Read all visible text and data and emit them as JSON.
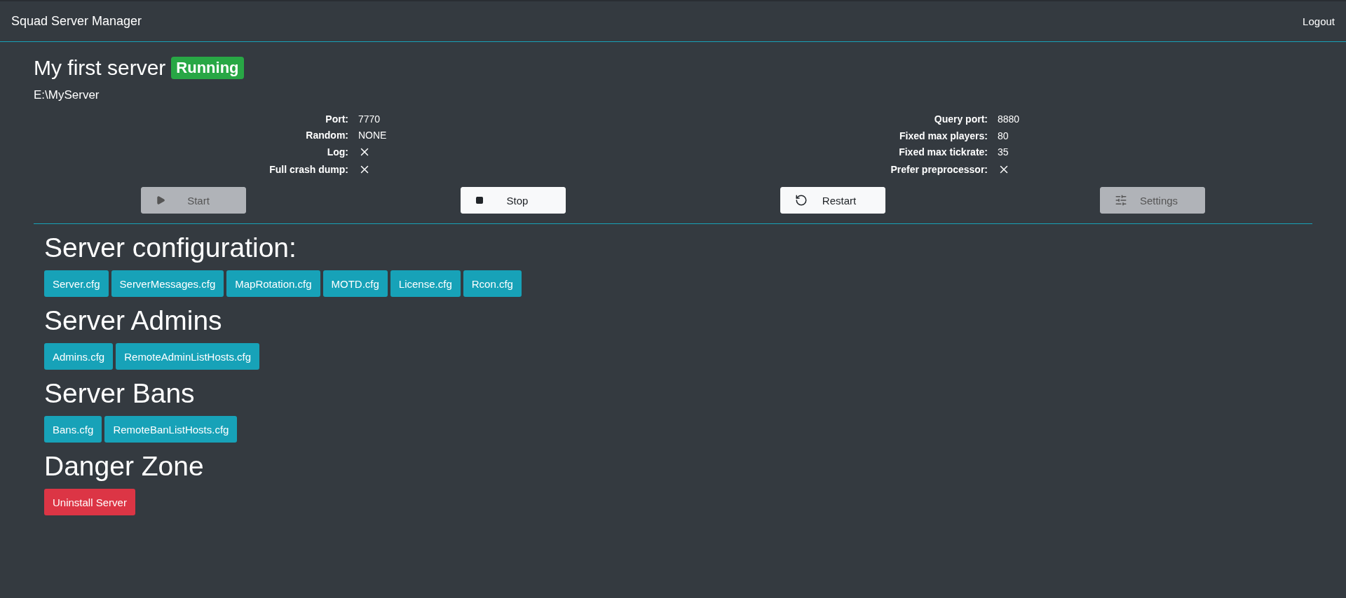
{
  "navbar": {
    "brand": "Squad Server Manager",
    "logout": "Logout"
  },
  "server": {
    "name": "My first server",
    "status": {
      "label": "Running",
      "kind": "running"
    },
    "path": "E:\\MyServer"
  },
  "info_columns": [
    [
      {
        "label": "Port:",
        "kind": "text",
        "value": "7770"
      },
      {
        "label": "Random:",
        "kind": "text",
        "value": "NONE"
      },
      {
        "label": "Log:",
        "kind": "flag",
        "on": false
      },
      {
        "label": "Full crash dump:",
        "kind": "flag",
        "on": false
      }
    ],
    [
      {
        "label": "Query port:",
        "kind": "text",
        "value": "8880"
      },
      {
        "label": "Fixed max players:",
        "kind": "text",
        "value": "80"
      },
      {
        "label": "Fixed max tickrate:",
        "kind": "text",
        "value": "35"
      },
      {
        "label": "Prefer preprocessor:",
        "kind": "flag",
        "on": false
      }
    ]
  ],
  "controls": [
    {
      "label": "Start",
      "kind": "start",
      "disabled": true
    },
    {
      "label": "Stop",
      "kind": "stop",
      "disabled": false
    },
    {
      "label": "Restart",
      "kind": "restart",
      "disabled": false
    },
    {
      "label": "Settings",
      "kind": "settings",
      "disabled": true
    }
  ],
  "sections": [
    {
      "title": "Server configuration:",
      "kind": "info",
      "files": [
        "Server.cfg",
        "ServerMessages.cfg",
        "MapRotation.cfg",
        "MOTD.cfg",
        "License.cfg",
        "Rcon.cfg"
      ]
    },
    {
      "title": "Server Admins",
      "kind": "info",
      "files": [
        "Admins.cfg",
        "RemoteAdminListHosts.cfg"
      ]
    },
    {
      "title": "Server Bans",
      "kind": "info",
      "files": [
        "Bans.cfg",
        "RemoteBanListHosts.cfg"
      ]
    },
    {
      "title": "Danger Zone",
      "kind": "danger",
      "files": [
        "Uninstall Server"
      ]
    }
  ]
}
